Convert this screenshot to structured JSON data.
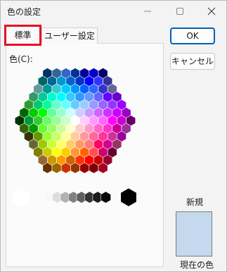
{
  "window": {
    "title": "色の設定",
    "controls": [
      "minimize-icon",
      "maximize-icon",
      "close-icon"
    ]
  },
  "tabs": [
    {
      "label": "標準",
      "selected": true
    },
    {
      "label": "ユーザー設定",
      "selected": false
    }
  ],
  "palette": {
    "label": "色(C):",
    "hex_rows": [
      [
        "#003366",
        "#336699",
        "#3366CC",
        "#003399",
        "#000099",
        "#0000CC",
        "#000066"
      ],
      [
        "#006666",
        "#006699",
        "#0099CC",
        "#0066CC",
        "#0033CC",
        "#0000FF",
        "#3333FF",
        "#333399"
      ],
      [
        "#669999",
        "#009999",
        "#33CCCC",
        "#00CCFF",
        "#0099FF",
        "#0066FF",
        "#3366FF",
        "#3333CC",
        "#666699"
      ],
      [
        "#339966",
        "#00CC99",
        "#00FFCC",
        "#00FFFF",
        "#33CCFF",
        "#3399FF",
        "#6699FF",
        "#6666FF",
        "#6600FF",
        "#6600CC"
      ],
      [
        "#339933",
        "#00CC66",
        "#00FF99",
        "#66FFCC",
        "#66FFFF",
        "#66CCFF",
        "#99CCFF",
        "#9999FF",
        "#9966FF",
        "#9933FF",
        "#9900FF"
      ],
      [
        "#006600",
        "#00CC00",
        "#00FF00",
        "#66FF99",
        "#99FFCC",
        "#CCFFFF",
        "#CCCCFF",
        "#CC99FF",
        "#CC66FF",
        "#CC33FF",
        "#CC00FF",
        "#9900CC"
      ],
      [
        "#003300",
        "#009933",
        "#33CC33",
        "#66FF66",
        "#99FF99",
        "#CCFFCC",
        "#FFFFFF",
        "#FFCCFF",
        "#FF99FF",
        "#FF66FF",
        "#FF00FF",
        "#CC00CC",
        "#660066"
      ],
      [
        "#336600",
        "#009900",
        "#66FF33",
        "#99FF66",
        "#CCFF99",
        "#FFFFCC",
        "#FFCCCC",
        "#FF99CC",
        "#FF66CC",
        "#FF33CC",
        "#CC0099",
        "#993399"
      ],
      [
        "#333300",
        "#669900",
        "#99FF33",
        "#CCFF66",
        "#FFFF99",
        "#FFCC99",
        "#FF9999",
        "#FF6699",
        "#FF3399",
        "#CC3399",
        "#990099"
      ],
      [
        "#666633",
        "#99CC00",
        "#CCFF33",
        "#FFFF66",
        "#FFCC66",
        "#FF9966",
        "#FF7C80",
        "#FF0066",
        "#D60093",
        "#993366"
      ],
      [
        "#808000",
        "#CCCC00",
        "#FFFF00",
        "#FFCC00",
        "#FF9933",
        "#FF6600",
        "#FF5050",
        "#CC0066",
        "#660033"
      ],
      [
        "#996633",
        "#CC9900",
        "#FF9900",
        "#CC6600",
        "#FF3300",
        "#FF0000",
        "#CC0000",
        "#990033"
      ],
      [
        "#663300",
        "#996600",
        "#CC3300",
        "#993300",
        "#990000",
        "#800000",
        "#A50021"
      ]
    ],
    "grays": [
      "#F8F8F8",
      "#DDDDDD",
      "#B2B2B2",
      "#808080",
      "#5F5F5F",
      "#333333",
      "#1C1C1C",
      "#080808"
    ],
    "white": "#FFFFFF",
    "black": "#000000"
  },
  "buttons": {
    "ok": "OK",
    "cancel": "キャンセル"
  },
  "preview": {
    "new_label": "新規",
    "current_label": "現在の色",
    "color": "#C4D8EE"
  }
}
